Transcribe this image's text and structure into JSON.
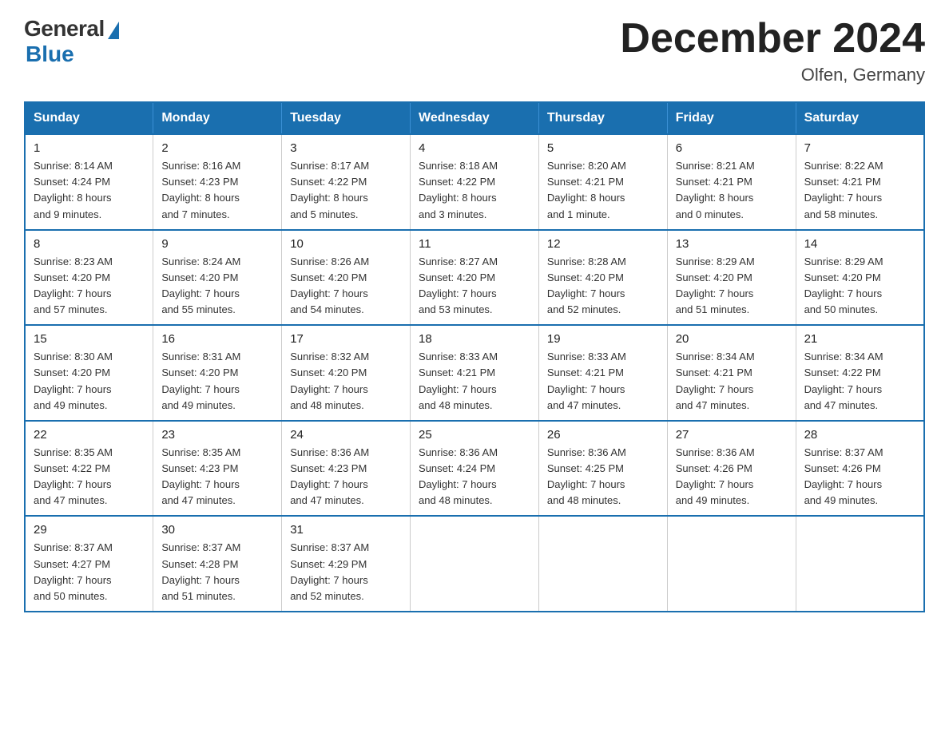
{
  "logo": {
    "general_text": "General",
    "blue_text": "Blue"
  },
  "title": "December 2024",
  "subtitle": "Olfen, Germany",
  "weekdays": [
    "Sunday",
    "Monday",
    "Tuesday",
    "Wednesday",
    "Thursday",
    "Friday",
    "Saturday"
  ],
  "weeks": [
    [
      {
        "day": "1",
        "sunrise": "8:14 AM",
        "sunset": "4:24 PM",
        "daylight": "8 hours and 9 minutes."
      },
      {
        "day": "2",
        "sunrise": "8:16 AM",
        "sunset": "4:23 PM",
        "daylight": "8 hours and 7 minutes."
      },
      {
        "day": "3",
        "sunrise": "8:17 AM",
        "sunset": "4:22 PM",
        "daylight": "8 hours and 5 minutes."
      },
      {
        "day": "4",
        "sunrise": "8:18 AM",
        "sunset": "4:22 PM",
        "daylight": "8 hours and 3 minutes."
      },
      {
        "day": "5",
        "sunrise": "8:20 AM",
        "sunset": "4:21 PM",
        "daylight": "8 hours and 1 minute."
      },
      {
        "day": "6",
        "sunrise": "8:21 AM",
        "sunset": "4:21 PM",
        "daylight": "8 hours and 0 minutes."
      },
      {
        "day": "7",
        "sunrise": "8:22 AM",
        "sunset": "4:21 PM",
        "daylight": "7 hours and 58 minutes."
      }
    ],
    [
      {
        "day": "8",
        "sunrise": "8:23 AM",
        "sunset": "4:20 PM",
        "daylight": "7 hours and 57 minutes."
      },
      {
        "day": "9",
        "sunrise": "8:24 AM",
        "sunset": "4:20 PM",
        "daylight": "7 hours and 55 minutes."
      },
      {
        "day": "10",
        "sunrise": "8:26 AM",
        "sunset": "4:20 PM",
        "daylight": "7 hours and 54 minutes."
      },
      {
        "day": "11",
        "sunrise": "8:27 AM",
        "sunset": "4:20 PM",
        "daylight": "7 hours and 53 minutes."
      },
      {
        "day": "12",
        "sunrise": "8:28 AM",
        "sunset": "4:20 PM",
        "daylight": "7 hours and 52 minutes."
      },
      {
        "day": "13",
        "sunrise": "8:29 AM",
        "sunset": "4:20 PM",
        "daylight": "7 hours and 51 minutes."
      },
      {
        "day": "14",
        "sunrise": "8:29 AM",
        "sunset": "4:20 PM",
        "daylight": "7 hours and 50 minutes."
      }
    ],
    [
      {
        "day": "15",
        "sunrise": "8:30 AM",
        "sunset": "4:20 PM",
        "daylight": "7 hours and 49 minutes."
      },
      {
        "day": "16",
        "sunrise": "8:31 AM",
        "sunset": "4:20 PM",
        "daylight": "7 hours and 49 minutes."
      },
      {
        "day": "17",
        "sunrise": "8:32 AM",
        "sunset": "4:20 PM",
        "daylight": "7 hours and 48 minutes."
      },
      {
        "day": "18",
        "sunrise": "8:33 AM",
        "sunset": "4:21 PM",
        "daylight": "7 hours and 48 minutes."
      },
      {
        "day": "19",
        "sunrise": "8:33 AM",
        "sunset": "4:21 PM",
        "daylight": "7 hours and 47 minutes."
      },
      {
        "day": "20",
        "sunrise": "8:34 AM",
        "sunset": "4:21 PM",
        "daylight": "7 hours and 47 minutes."
      },
      {
        "day": "21",
        "sunrise": "8:34 AM",
        "sunset": "4:22 PM",
        "daylight": "7 hours and 47 minutes."
      }
    ],
    [
      {
        "day": "22",
        "sunrise": "8:35 AM",
        "sunset": "4:22 PM",
        "daylight": "7 hours and 47 minutes."
      },
      {
        "day": "23",
        "sunrise": "8:35 AM",
        "sunset": "4:23 PM",
        "daylight": "7 hours and 47 minutes."
      },
      {
        "day": "24",
        "sunrise": "8:36 AM",
        "sunset": "4:23 PM",
        "daylight": "7 hours and 47 minutes."
      },
      {
        "day": "25",
        "sunrise": "8:36 AM",
        "sunset": "4:24 PM",
        "daylight": "7 hours and 48 minutes."
      },
      {
        "day": "26",
        "sunrise": "8:36 AM",
        "sunset": "4:25 PM",
        "daylight": "7 hours and 48 minutes."
      },
      {
        "day": "27",
        "sunrise": "8:36 AM",
        "sunset": "4:26 PM",
        "daylight": "7 hours and 49 minutes."
      },
      {
        "day": "28",
        "sunrise": "8:37 AM",
        "sunset": "4:26 PM",
        "daylight": "7 hours and 49 minutes."
      }
    ],
    [
      {
        "day": "29",
        "sunrise": "8:37 AM",
        "sunset": "4:27 PM",
        "daylight": "7 hours and 50 minutes."
      },
      {
        "day": "30",
        "sunrise": "8:37 AM",
        "sunset": "4:28 PM",
        "daylight": "7 hours and 51 minutes."
      },
      {
        "day": "31",
        "sunrise": "8:37 AM",
        "sunset": "4:29 PM",
        "daylight": "7 hours and 52 minutes."
      },
      null,
      null,
      null,
      null
    ]
  ],
  "labels": {
    "sunrise": "Sunrise:",
    "sunset": "Sunset:",
    "daylight": "Daylight:"
  }
}
